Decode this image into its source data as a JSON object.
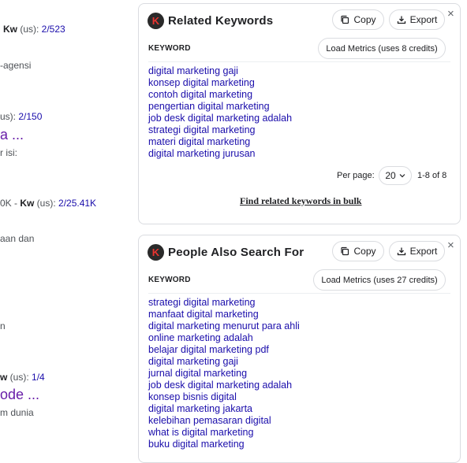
{
  "left": {
    "line1_kw": "Kw",
    "line1_rest": " (us): ",
    "line1_link": "2/523",
    "line2": "-agensi",
    "line3_pre": "us): ",
    "line3_link": "2/150",
    "line4": "a ...",
    "line5": "r isi:",
    "line6_pre": "0K - ",
    "line6_kw": "Kw",
    "line6_rest": " (us): ",
    "line6_link": "2/25.41K",
    "line7": "aan dan",
    "line8": "n",
    "line9_kw": "w",
    "line9_rest": " (us): ",
    "line9_link": "1/4",
    "line10": "ode ...",
    "line11": "m dunia"
  },
  "related": {
    "logo_letter": "K",
    "title": "Related Keywords",
    "copy_label": "Copy",
    "export_label": "Export",
    "close": "×",
    "column_header": "KEYWORD",
    "load_label": "Load Metrics (uses 8 credits)",
    "keywords": [
      "digital marketing gaji",
      "konsep digital marketing",
      "contoh digital marketing",
      "pengertian digital marketing",
      "job desk digital marketing adalah",
      "strategi digital marketing",
      "materi digital marketing",
      "digital marketing jurusan"
    ],
    "per_page_label": "Per page:",
    "per_page_value": "20",
    "range": "1-8 of 8",
    "bulk_link": "Find related keywords in bulk"
  },
  "people": {
    "logo_letter": "K",
    "title": "People Also Search For",
    "copy_label": "Copy",
    "export_label": "Export",
    "close": "×",
    "column_header": "KEYWORD",
    "load_label": "Load Metrics (uses 27 credits)",
    "keywords": [
      "strategi digital marketing",
      "manfaat digital marketing",
      "digital marketing menurut para ahli",
      "online marketing adalah",
      "belajar digital marketing pdf",
      "digital marketing gaji",
      "jurnal digital marketing",
      "job desk digital marketing adalah",
      "konsep bisnis digital",
      "digital marketing jakarta",
      "kelebihan pemasaran digital",
      "what is digital marketing",
      "buku digital marketing"
    ]
  }
}
